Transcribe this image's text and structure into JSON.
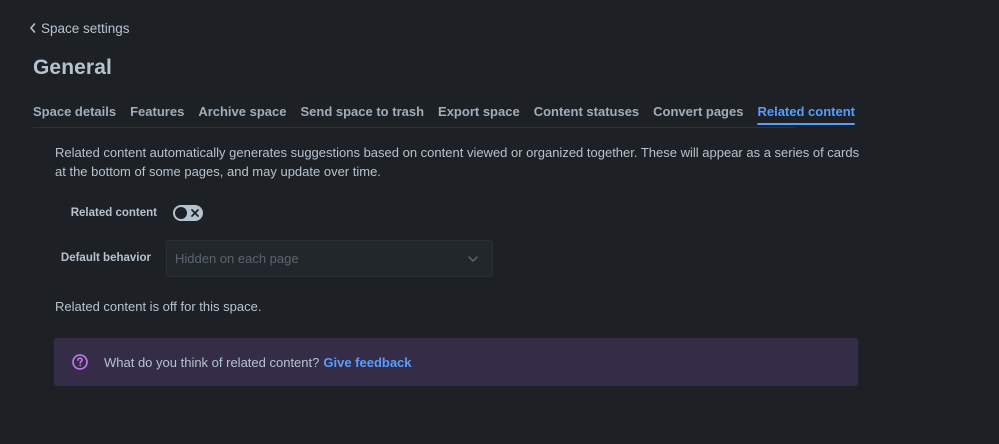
{
  "header": {
    "back_label": "Space settings",
    "title": "General"
  },
  "tabs": [
    {
      "label": "Space details",
      "active": false
    },
    {
      "label": "Features",
      "active": false
    },
    {
      "label": "Archive space",
      "active": false
    },
    {
      "label": "Send space to trash",
      "active": false
    },
    {
      "label": "Export space",
      "active": false
    },
    {
      "label": "Content statuses",
      "active": false
    },
    {
      "label": "Convert pages",
      "active": false
    },
    {
      "label": "Related content",
      "active": true
    }
  ],
  "related_content": {
    "description": "Related content automatically generates suggestions based on content viewed or organized together. These will appear as a series of cards at the bottom of some pages, and may update over time.",
    "toggle_label": "Related content",
    "toggle_state": "off",
    "default_behavior_label": "Default behavior",
    "default_behavior_value": "Hidden on each page",
    "status_text": "Related content is off for this space."
  },
  "feedback": {
    "question": "What do you think of related content?",
    "link_label": "Give feedback"
  },
  "icons": {
    "back": "chevron-left-icon",
    "toggle_off": "close-icon",
    "select": "chevron-down-icon",
    "feedback": "question-circle-icon"
  },
  "colors": {
    "background": "#1d2125",
    "text": "#b6c2cf",
    "accent": "#579dff",
    "banner_background": "#352c47",
    "banner_icon": "#c27ded"
  }
}
